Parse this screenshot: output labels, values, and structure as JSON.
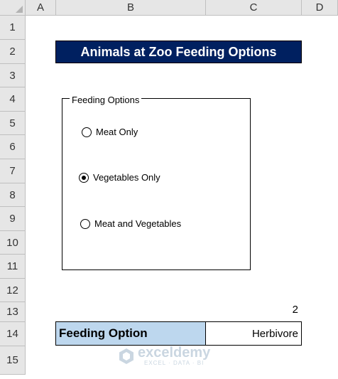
{
  "columns": [
    "A",
    "B",
    "C",
    "D"
  ],
  "rows": [
    "1",
    "2",
    "3",
    "4",
    "5",
    "6",
    "7",
    "8",
    "9",
    "10",
    "11",
    "12",
    "13",
    "14",
    "15"
  ],
  "title": "Animals at Zoo Feeding Options",
  "group": {
    "label": "Feeding Options",
    "options": [
      {
        "label": "Meat Only",
        "checked": false
      },
      {
        "label": "Vegetables Only",
        "checked": true
      },
      {
        "label": "Meat and Vegetables",
        "checked": false
      }
    ]
  },
  "linked_cell_value": "2",
  "result": {
    "label": "Feeding Option",
    "value": "Herbivore"
  },
  "watermark": {
    "name": "exceldemy",
    "tagline": "EXCEL · DATA · BI"
  },
  "colors": {
    "title_bg": "#002060",
    "label_bg": "#bdd7ee"
  }
}
